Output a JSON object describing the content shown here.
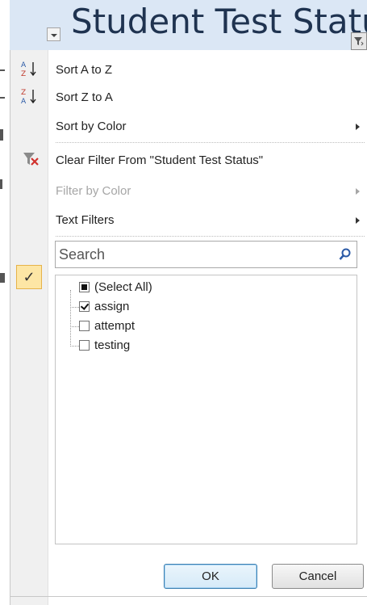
{
  "header": {
    "title": "Student Test Statu"
  },
  "menu": {
    "sort_a_z": "Sort A to Z",
    "sort_z_a": "Sort Z to A",
    "sort_by_color": "Sort by Color",
    "clear_filter": "Clear Filter From \"Student Test Status\"",
    "filter_by_color": "Filter by Color",
    "text_filters": "Text Filters"
  },
  "search": {
    "placeholder": "Search",
    "value": ""
  },
  "list": {
    "items": [
      {
        "label": "(Select All)",
        "state": "partial"
      },
      {
        "label": "assign",
        "state": "checked"
      },
      {
        "label": "attempt",
        "state": "unchecked"
      },
      {
        "label": "testing",
        "state": "unchecked"
      }
    ]
  },
  "buttons": {
    "ok": "OK",
    "cancel": "Cancel"
  },
  "side_marker": "✓",
  "colors": {
    "header_bg": "#dbe7f5",
    "ok_border": "#3c7fb1",
    "side_check_bg": "#fde6a5"
  }
}
